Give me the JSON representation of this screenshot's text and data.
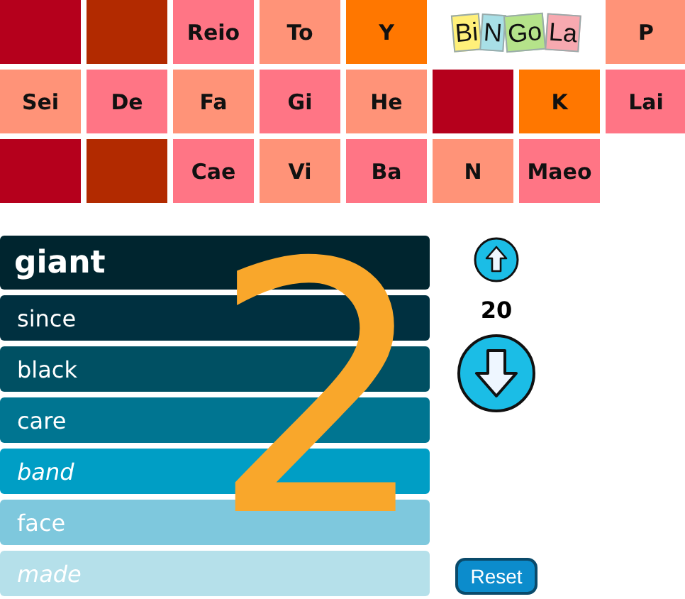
{
  "grid": [
    {
      "kind": "cell",
      "color": "#b5001c"
    },
    {
      "kind": "cell",
      "color": "#b22a00"
    },
    {
      "kind": "cell",
      "text": "Reio",
      "color": "#ff7585"
    },
    {
      "kind": "cell",
      "text": "To",
      "color": "#ff9378"
    },
    {
      "kind": "cell",
      "text": "Y",
      "color": "#ff7700"
    },
    {
      "kind": "logo",
      "tiles": [
        {
          "text": "Bi",
          "color": "#fff07a"
        },
        {
          "text": "N",
          "color": "#a8dfe6"
        },
        {
          "text": "Go",
          "color": "#b5e38a"
        },
        {
          "text": "La",
          "color": "#f7a9b0"
        }
      ]
    },
    {
      "kind": "cell",
      "text": "P",
      "color": "#ff9378"
    },
    {
      "kind": "cell",
      "text": "Sei",
      "color": "#ff9378"
    },
    {
      "kind": "cell",
      "text": "De",
      "color": "#ff7585"
    },
    {
      "kind": "cell",
      "text": "Fa",
      "color": "#ff9378"
    },
    {
      "kind": "cell",
      "text": "Gi",
      "color": "#ff7585"
    },
    {
      "kind": "cell",
      "text": "He",
      "color": "#ff9378"
    },
    {
      "kind": "cell",
      "color": "#b5001c"
    },
    {
      "kind": "cell",
      "text": "K",
      "color": "#ff7700"
    },
    {
      "kind": "cell",
      "text": "Lai",
      "color": "#ff7585"
    },
    {
      "kind": "cell",
      "color": "#b5001c"
    },
    {
      "kind": "cell",
      "color": "#b22a00"
    },
    {
      "kind": "cell",
      "text": "Cae",
      "color": "#ff7585"
    },
    {
      "kind": "cell",
      "text": "Vi",
      "color": "#ff9378"
    },
    {
      "kind": "cell",
      "text": "Ba",
      "color": "#ff7585"
    },
    {
      "kind": "cell",
      "text": "N",
      "color": "#ff9378"
    },
    {
      "kind": "cell",
      "text": "Maeo",
      "color": "#ff7585"
    }
  ],
  "words": [
    {
      "text": "giant",
      "color": "#00252f",
      "kind": "head",
      "italic": false
    },
    {
      "text": "since",
      "color": "#003040",
      "kind": "word",
      "italic": false
    },
    {
      "text": "black",
      "color": "#005063",
      "kind": "word",
      "italic": false
    },
    {
      "text": "care",
      "color": "#007591",
      "kind": "word",
      "italic": false
    },
    {
      "text": "band",
      "color": "#009ec5",
      "kind": "word",
      "italic": true
    },
    {
      "text": "face",
      "color": "#7ec8dd",
      "kind": "word",
      "italic": false
    },
    {
      "text": "made",
      "color": "#b5e0ea",
      "kind": "word",
      "italic": true
    }
  ],
  "overlay_number": "2",
  "counter": "20",
  "reset_button": "Reset"
}
